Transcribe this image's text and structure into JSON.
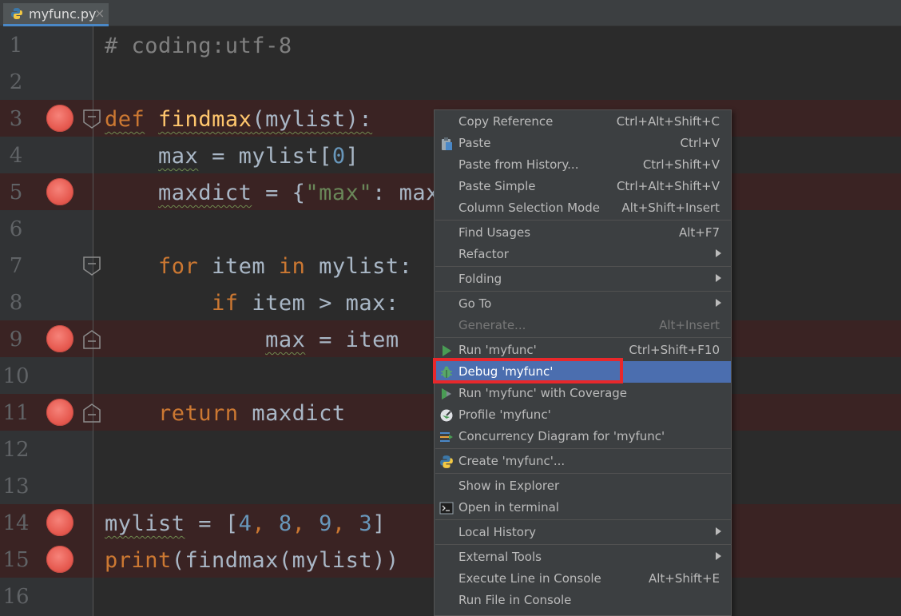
{
  "tab": {
    "filename": "myfunc.py",
    "close_glyph": "×",
    "icon": "python-file-icon"
  },
  "line_numbers": [
    "1",
    "2",
    "3",
    "4",
    "5",
    "6",
    "7",
    "8",
    "9",
    "10",
    "11",
    "12",
    "13",
    "14",
    "15",
    "16"
  ],
  "code": {
    "l1": "# coding:utf-8",
    "l3_def": "def",
    "l3_fn": "findmax",
    "l3_rest": "(mylist):",
    "l4_indent": "    ",
    "l4_var": "max",
    "l4_rest": " = mylist[",
    "l4_num": "0",
    "l4_end": "]",
    "l5_indent": "    ",
    "l5_var": "maxdict",
    "l5_rest": " = {",
    "l5_str": "\"max\"",
    "l5_end": ": max}",
    "l7_indent": "    ",
    "l7_for": "for",
    "l7_mid": " item ",
    "l7_in": "in",
    "l7_end": " mylist:",
    "l8_indent": "        ",
    "l8_if": "if",
    "l8_end": " item > max:",
    "l9_indent": "            ",
    "l9_var": "max",
    "l9_end": " = item",
    "l11_indent": "    ",
    "l11_ret": "return",
    "l11_end": " maxdict",
    "l14_var": "mylist",
    "l14_a": " = [",
    "l14_n1": "4",
    "l14_c1": ", ",
    "l14_n2": "8",
    "l14_c2": ", ",
    "l14_n3": "9",
    "l14_c3": ", ",
    "l14_n4": "3",
    "l14_end": "]",
    "l15_print": "print",
    "l15_end": "(findmax(mylist))"
  },
  "menu": {
    "copy_reference": {
      "label": "Copy Reference",
      "shortcut": "Ctrl+Alt+Shift+C"
    },
    "paste": {
      "label": "Paste",
      "shortcut": "Ctrl+V",
      "icon": "clipboard-icon"
    },
    "paste_history": {
      "label": "Paste from History...",
      "shortcut": "Ctrl+Shift+V"
    },
    "paste_simple": {
      "label": "Paste Simple",
      "shortcut": "Ctrl+Alt+Shift+V"
    },
    "column_selection": {
      "label": "Column Selection Mode",
      "shortcut": "Alt+Shift+Insert"
    },
    "find_usages": {
      "label": "Find Usages",
      "shortcut": "Alt+F7"
    },
    "refactor": {
      "label": "Refactor"
    },
    "folding": {
      "label": "Folding"
    },
    "go_to": {
      "label": "Go To"
    },
    "generate": {
      "label": "Generate...",
      "shortcut": "Alt+Insert",
      "disabled": true
    },
    "run": {
      "label": "Run 'myfunc'",
      "shortcut": "Ctrl+Shift+F10",
      "icon": "run-icon"
    },
    "debug": {
      "label": "Debug 'myfunc'",
      "icon": "debug-icon",
      "selected": true
    },
    "run_coverage": {
      "label": "Run 'myfunc' with Coverage",
      "icon": "coverage-icon"
    },
    "profile": {
      "label": "Profile 'myfunc'",
      "icon": "profile-icon"
    },
    "concurrency": {
      "label": "Concurrency Diagram for 'myfunc'",
      "icon": "concurrency-icon"
    },
    "create": {
      "label": "Create 'myfunc'...",
      "icon": "python-icon"
    },
    "show_explorer": {
      "label": "Show in Explorer"
    },
    "open_terminal": {
      "label": "Open in terminal",
      "icon": "terminal-icon"
    },
    "local_history": {
      "label": "Local History"
    },
    "external_tools": {
      "label": "External Tools"
    },
    "execute_line": {
      "label": "Execute Line in Console",
      "shortcut": "Alt+Shift+E"
    },
    "run_file_console": {
      "label": "Run File in Console"
    }
  },
  "colors": {
    "editor_bg": "#2b2b2b",
    "breakpoint_line": "#3a2323",
    "breakpoint": "#e65a50",
    "keyword": "#cc7832",
    "function": "#ffc66d",
    "number": "#6897bb",
    "string": "#6a8759",
    "menu_selected": "#4b6eaf",
    "highlight_box": "#e8282b"
  }
}
